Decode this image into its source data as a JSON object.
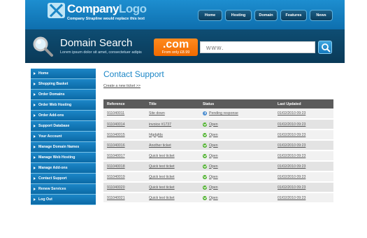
{
  "header": {
    "logo_company": "Company",
    "logo_logo": "Logo",
    "strapline": "Company Strapline would replace this text",
    "nav": [
      "Home",
      "Hosting",
      "Domain",
      "Features",
      "News"
    ]
  },
  "search": {
    "title": "Domain Search",
    "subtitle": "Lorem ipsum dolor sit amet, consectetuer adipis",
    "tld": ".com",
    "tld_price": "From only £8.99",
    "placeholder": "www."
  },
  "sidebar": {
    "items": [
      "Home",
      "Shopping Basket",
      "Order Domains",
      "Order Web Hosting",
      "Order Add-ons",
      "Support Database",
      "Your Account",
      "Manage Domain Names",
      "Manage Web Hosting",
      "Manage Add-ons",
      "Contact Support",
      "Renew Services",
      "Log Out"
    ]
  },
  "main": {
    "title": "Contact Support",
    "create_link": "Create a new ticket >>",
    "columns": [
      "Reference",
      "Title",
      "Status",
      "Last Updated"
    ],
    "tickets": [
      {
        "ref": "911040011",
        "title": "Site down",
        "status": "Pending response",
        "status_type": "pending",
        "updated": "01/02/2010 09:23"
      },
      {
        "ref": "911040014",
        "title": "invoice #1737",
        "status": "Open",
        "status_type": "open",
        "updated": "01/02/2010 09:23"
      },
      {
        "ref": "911040015",
        "title": "hfgdgfds",
        "status": "Open",
        "status_type": "open",
        "updated": "01/02/2010 09:23"
      },
      {
        "ref": "911040016",
        "title": "Another ticket",
        "status": "Open",
        "status_type": "open",
        "updated": "01/02/2010 09:23"
      },
      {
        "ref": "911040017",
        "title": "Quick test ticket",
        "status": "Open",
        "status_type": "open",
        "updated": "01/02/2010 09:23"
      },
      {
        "ref": "911040018",
        "title": "Quick test ticket",
        "status": "Open",
        "status_type": "open",
        "updated": "01/02/2010 09:23"
      },
      {
        "ref": "911040019",
        "title": "Quick test ticket",
        "status": "Open",
        "status_type": "open",
        "updated": "01/02/2010 09:23"
      },
      {
        "ref": "911040020",
        "title": "Quick test ticket",
        "status": "Open",
        "status_type": "open",
        "updated": "01/02/2010 09:23"
      },
      {
        "ref": "911040021",
        "title": "Quick test ticket",
        "status": "Open",
        "status_type": "open",
        "updated": "01/02/2010 09:23"
      }
    ]
  },
  "icons": {
    "logo": "company-logo-icon",
    "search": "magnifier-icon",
    "go": "search-go-icon",
    "open": "check-circle-icon",
    "pending": "pending-info-icon"
  },
  "colors": {
    "brand_blue": "#1b86c6",
    "dark_band": "#0e4d73",
    "accent_orange": "#f06a00",
    "open_green": "#4bb02a"
  }
}
